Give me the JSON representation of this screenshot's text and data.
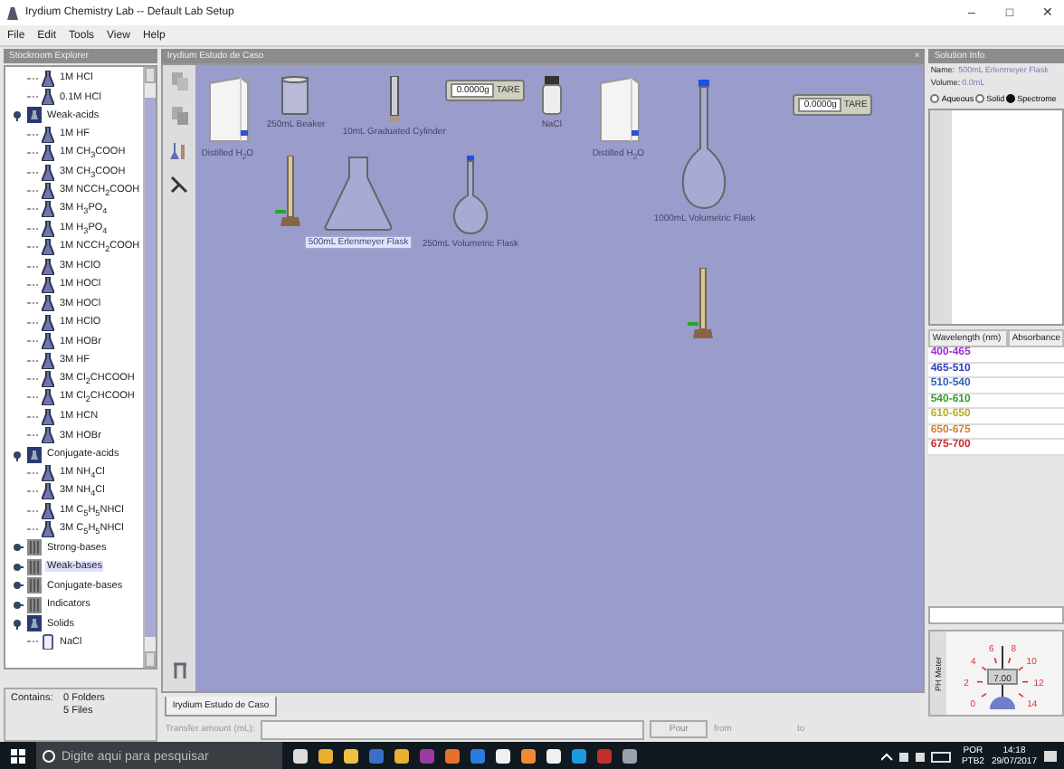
{
  "window": {
    "title": "Irydium Chemistry Lab -- Default Lab Setup",
    "controls": [
      "–",
      "□",
      "✕"
    ]
  },
  "menu": [
    "File",
    "Edit",
    "Tools",
    "View",
    "Help"
  ],
  "explorer": {
    "title": "Stockroom Explorer",
    "tree": [
      {
        "kind": "continued",
        "children": [
          {
            "kind": "flask",
            "label": "1M HCl",
            "selected": false
          },
          {
            "kind": "flask",
            "label": "0.1M HCl",
            "selected": false
          }
        ]
      },
      {
        "kind": "folder",
        "label": "Weak-acids",
        "expanded": true,
        "selected": false,
        "children": [
          {
            "kind": "flask",
            "label": "1M HF",
            "selected": false
          },
          {
            "kind": "flask",
            "label": "1M CH$_{3}$COOH",
            "selected": false
          },
          {
            "kind": "flask",
            "label": "3M CH$_{3}$COOH",
            "selected": false
          },
          {
            "kind": "flask",
            "label": "3M NCCH$_{2}$COOH",
            "selected": false
          },
          {
            "kind": "flask",
            "label": "3M H$_{3}$PO$_{4}$",
            "selected": false
          },
          {
            "kind": "flask",
            "label": "1M H$_{3}$PO$_{4}$",
            "selected": false
          },
          {
            "kind": "flask",
            "label": "1M NCCH$_{2}$COOH",
            "selected": false
          },
          {
            "kind": "flask",
            "label": "3M HClO",
            "selected": false
          },
          {
            "kind": "flask",
            "label": "1M HOCl",
            "selected": false
          },
          {
            "kind": "flask",
            "label": "3M HOCl",
            "selected": false
          },
          {
            "kind": "flask",
            "label": "1M HClO",
            "selected": false
          },
          {
            "kind": "flask",
            "label": "1M HOBr",
            "selected": false
          },
          {
            "kind": "flask",
            "label": "3M HF",
            "selected": false
          },
          {
            "kind": "flask",
            "label": "3M Cl$_{2}$CHCOOH",
            "selected": false
          },
          {
            "kind": "flask",
            "label": "1M Cl$_{2}$CHCOOH",
            "selected": false
          },
          {
            "kind": "flask",
            "label": "1M HCN",
            "selected": false
          },
          {
            "kind": "flask",
            "label": "3M HOBr",
            "selected": false
          }
        ]
      },
      {
        "kind": "folder",
        "label": "Conjugate-acids",
        "expanded": true,
        "selected": false,
        "children": [
          {
            "kind": "flask",
            "label": "1M NH$_{4}$Cl",
            "selected": false
          },
          {
            "kind": "flask",
            "label": "3M NH$_{4}$Cl",
            "selected": false
          },
          {
            "kind": "flask",
            "label": "1M C$_{5}$H$_{5}$NHCl",
            "selected": false
          },
          {
            "kind": "flask",
            "label": "3M C$_{5}$H$_{5}$NHCl",
            "selected": false
          }
        ]
      },
      {
        "kind": "folder",
        "label": "Strong-bases",
        "expanded": false,
        "selected": false
      },
      {
        "kind": "folder",
        "label": "Weak-bases",
        "expanded": false,
        "selected": true
      },
      {
        "kind": "folder",
        "label": "Conjugate-bases",
        "expanded": false,
        "selected": false
      },
      {
        "kind": "folder",
        "label": "Indicators",
        "expanded": false,
        "selected": false
      },
      {
        "kind": "folder",
        "label": "Solids",
        "expanded": true,
        "selected": false,
        "children": [
          {
            "kind": "jar",
            "label": "NaCl",
            "selected": false
          }
        ]
      }
    ],
    "contains_label": "Contains:",
    "folders": "0 Folders",
    "files": "5 Files"
  },
  "workbench": {
    "title": "Irydium Estudo de Caso",
    "close": "×",
    "items": [
      {
        "kind": "carboy",
        "label": "Distilled H$_{2}$O",
        "selected": false
      },
      {
        "kind": "beaker",
        "label": "250mL Beaker",
        "selected": false
      },
      {
        "kind": "cylinder",
        "label": "10mL Graduated Cylinder",
        "selected": false
      },
      {
        "kind": "balance",
        "reading": "0.0000g",
        "button": "TARE"
      },
      {
        "kind": "bottle",
        "label": "NaCl",
        "selected": false
      },
      {
        "kind": "carboy",
        "label": "Distilled H$_{2}$O",
        "selected": false
      },
      {
        "kind": "volumetric-large",
        "label": "1000mL Volumetric Flask",
        "selected": false
      },
      {
        "kind": "balance",
        "reading": "0.0000g",
        "button": "TARE"
      },
      {
        "kind": "burette"
      },
      {
        "kind": "erlenmeyer",
        "label": "500mL Erlenmeyer Flask",
        "selected": true
      },
      {
        "kind": "volumetric",
        "label": "250mL Volumetric Flask",
        "selected": false
      },
      {
        "kind": "burette"
      }
    ],
    "tab": "Irydium Estudo de Caso"
  },
  "solution_info": {
    "title": "Solution Info.",
    "name_label": "Name:",
    "name": "500mL Erlenmeyer Flask",
    "volume_label": "Volume:",
    "volume": "0.0mL",
    "modes": [
      {
        "label": "Aqueous",
        "selected": false
      },
      {
        "label": "Solid",
        "selected": false
      },
      {
        "label": "Spectrome",
        "selected": true
      }
    ],
    "table": {
      "columns": [
        "Wavelength (nm)",
        "Absorbance"
      ],
      "rows": [
        {
          "range": "400-465",
          "color": "#9a30d0"
        },
        {
          "range": "465-510",
          "color": "#3040c0"
        },
        {
          "range": "510-540",
          "color": "#3060c0"
        },
        {
          "range": "540-610",
          "color": "#30a030"
        },
        {
          "range": "610-650",
          "color": "#b8b020"
        },
        {
          "range": "650-675",
          "color": "#d08030"
        },
        {
          "range": "675-700",
          "color": "#c03030"
        }
      ]
    },
    "ph_meter": {
      "label": "PH Meter",
      "scale": [
        "0",
        "2",
        "4",
        "6",
        "8",
        "10",
        "12",
        "14"
      ],
      "reading": "7.00"
    }
  },
  "transfer": {
    "label": "Transfer amount (mL):",
    "button": "Pour",
    "from": "from",
    "to": "to"
  },
  "taskbar": {
    "search_placeholder": "Digite aqui para pesquisar",
    "language": "POR",
    "layout": "PTB2",
    "time": "14:18",
    "date": "29/07/2017"
  }
}
